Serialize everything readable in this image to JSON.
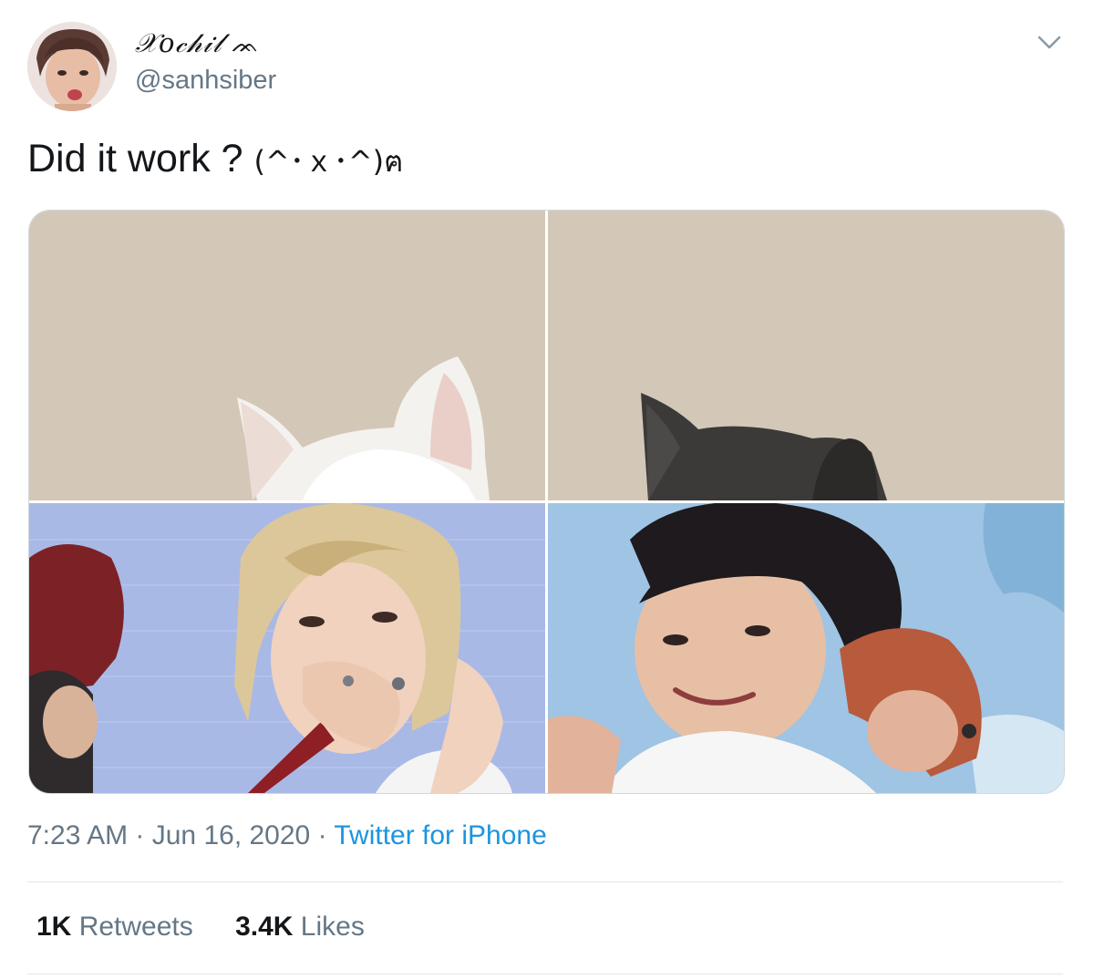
{
  "user": {
    "display_name": "𝒳𝑜𝒸𝒽𝒾𝓁",
    "name_emoji": "ᨏ",
    "handle": "@sanhsiber"
  },
  "tweet": {
    "text": "Did it work ? ",
    "emoticon": "(^･ｘ･^)ฅ"
  },
  "media": {
    "tiles": [
      {
        "name": "cat-white",
        "kind": "white cat ears"
      },
      {
        "name": "cat-black",
        "kind": "black cat ears"
      },
      {
        "name": "blonde-singer",
        "kind": "photo"
      },
      {
        "name": "dark-hair-singer",
        "kind": "photo"
      }
    ]
  },
  "meta": {
    "time": "7:23 AM",
    "separator": " · ",
    "date": "Jun 16, 2020",
    "source": "Twitter for iPhone"
  },
  "stats": {
    "retweets_count": "1K",
    "retweets_label": " Retweets",
    "likes_count": "3.4K",
    "likes_label": " Likes"
  },
  "icons": {
    "menu": "chevron-down-icon"
  },
  "colors": {
    "link": "#1b95e0",
    "secondary_text": "#657786",
    "beige_bg": "#d3c8b7",
    "stage_blue": "#a9b9e6"
  }
}
